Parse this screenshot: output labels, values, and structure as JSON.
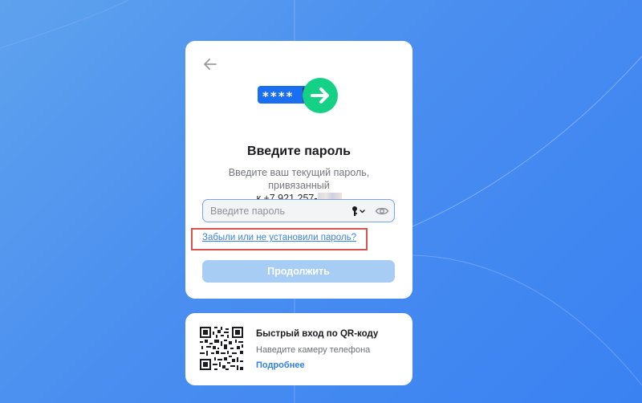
{
  "login": {
    "title": "Введите пароль",
    "subtitle": "Введите ваш текущий пароль, привязанный",
    "phone_prefix": "к",
    "phone": "+7 921 257-",
    "password_placeholder": "Введите пароль",
    "password_value": "",
    "forgot_link": "Забыли или не установили пароль?",
    "continue_label": "Продолжить",
    "illustration_mask": "****"
  },
  "qr": {
    "title": "Быстрый вход по QR-коду",
    "subtitle": "Наведите камеру телефона",
    "more_link": "Подробнее"
  },
  "icons": {
    "back": "arrow-left-icon",
    "key": "key-icon",
    "eye": "eye-icon",
    "qr": "qr-code-icon"
  },
  "colors": {
    "background": "#4a8ef0",
    "accent_link": "#3b82d9",
    "button_disabled": "#a8cdf5",
    "field_border": "#73a6ee",
    "illustration_green": "#14d186",
    "illustration_blue": "#1a6ef0",
    "highlight": "#d9534f"
  }
}
